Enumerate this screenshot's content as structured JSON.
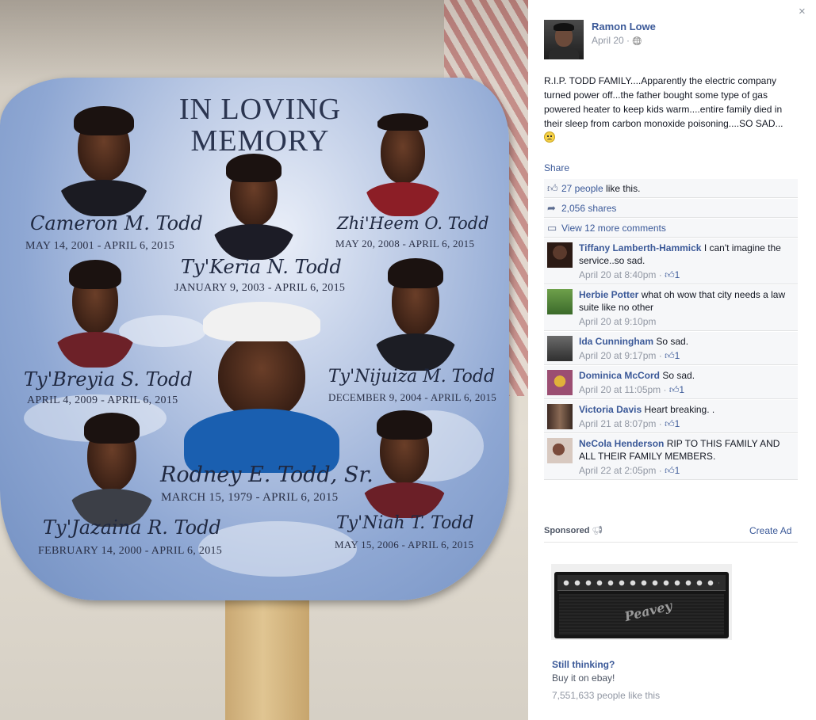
{
  "photo": {
    "title": "IN LOVING MEMORY",
    "people": [
      {
        "name": "Cameron M. Todd",
        "dates": "MAY 14, 2001 - APRIL 6, 2015"
      },
      {
        "name": "Ty'Keria N. Todd",
        "dates": "JANUARY 9, 2003 - APRIL 6, 2015"
      },
      {
        "name": "Zhi'Heem O. Todd",
        "dates": "MAY 20, 2008 - APRIL 6, 2015"
      },
      {
        "name": "Ty'Breyia S. Todd",
        "dates": "APRIL 4, 2009 - APRIL 6, 2015"
      },
      {
        "name": "Ty'Nijuiza M. Todd",
        "dates": "DECEMBER 9, 2004 - APRIL 6, 2015"
      },
      {
        "name": "Rodney E. Todd, Sr.",
        "dates": "MARCH 15, 1979 - APRIL 6, 2015"
      },
      {
        "name": "Ty'Jazaina R. Todd",
        "dates": "FEBRUARY 14, 2000 - APRIL 6, 2015"
      },
      {
        "name": "Ty'Niah T. Todd",
        "dates": "MAY 15, 2006 - APRIL 6, 2015"
      }
    ]
  },
  "post": {
    "close_icon": "×",
    "author": "Ramon Lowe",
    "date": "April 20 · ",
    "privacy_icon": "🌐",
    "text": "R.I.P. TODD FAMILY....Apparently the electric company turned power off...the father bought some type of gas powered heater to keep kids warm....entire family died in their sleep from carbon monoxide poisoning....SO SAD...",
    "share_label": "Share"
  },
  "ufi": {
    "likes_link": "27 people",
    "likes_suffix": " like this.",
    "shares": "2,056 shares",
    "view_more": "View 12 more comments"
  },
  "comments": [
    {
      "author": "Tiffany Lamberth-Hammick",
      "text": "I can't imagine the service..so sad.",
      "time": "April 20 at 8:40pm · ",
      "likes": "1"
    },
    {
      "author": "Herbie Potter",
      "text": "what oh wow that city needs a law suite like no other",
      "time": "April 20 at 9:10pm",
      "likes": ""
    },
    {
      "author": "Ida Cunningham",
      "text": "So sad.",
      "time": "April 20 at 9:17pm · ",
      "likes": "1"
    },
    {
      "author": "Dominica McCord",
      "text": "So sad.",
      "time": "April 20 at 11:05pm · ",
      "likes": "1"
    },
    {
      "author": "Victoria Davis",
      "text": "Heart breaking. .",
      "time": "April 21 at 8:07pm · ",
      "likes": "1"
    },
    {
      "author": "NeCola Henderson",
      "text": "RIP TO THIS FAMILY AND ALL THEIR FAMILY MEMBERS.",
      "time": "April 22 at 2:05pm · ",
      "likes": "1"
    }
  ],
  "ad": {
    "sponsored_label": "Sponsored",
    "create_ad_label": "Create Ad",
    "image_logo": "Peavey",
    "title": "Still thinking?",
    "subtitle": "Buy it on ebay!",
    "likes": "7,551,633 people like this"
  },
  "colors": {
    "link": "#3b5998",
    "muted": "#9197a3",
    "ufi_bg": "#f6f7f9",
    "fan_blue": "#8ea7d3"
  },
  "icons": [
    "close-icon",
    "globe-icon",
    "like-icon",
    "share-icon",
    "comment-icon",
    "megaphone-icon"
  ]
}
